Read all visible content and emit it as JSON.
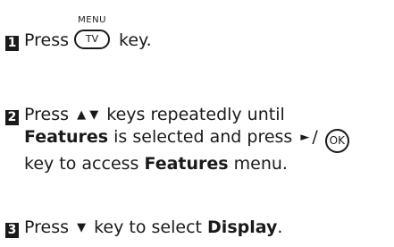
{
  "steps": [
    {
      "number": "1",
      "text_before": "Press",
      "key_top_label": "MENU",
      "key_label": "TV",
      "text_after": "key."
    },
    {
      "number": "2",
      "line1_text": "Press",
      "line1_keys": "▲ ▼",
      "line1_rest": "keys repeatedly until",
      "line2_bold": "Features",
      "line2_mid": "is selected and press",
      "line2_arrow": "►",
      "line2_sep": "/",
      "ok_key": "OK",
      "line3_text": "key to access",
      "line3_bold": "Features",
      "line3_end": "menu."
    },
    {
      "number": "3",
      "text": "Press",
      "key": "▼",
      "mid": "key to select",
      "bold": "Display",
      "end": "."
    }
  ]
}
